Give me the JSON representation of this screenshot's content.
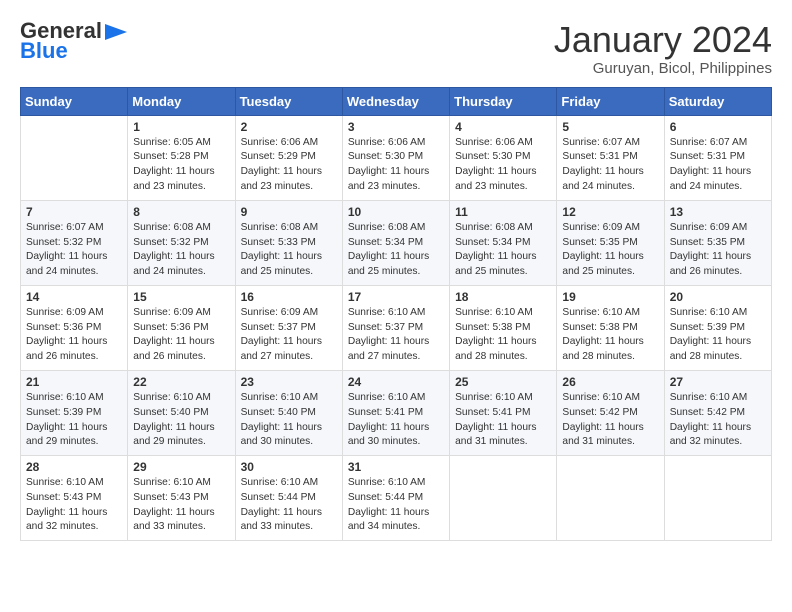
{
  "header": {
    "logo_general": "General",
    "logo_blue": "Blue",
    "month_title": "January 2024",
    "location": "Guruyan, Bicol, Philippines"
  },
  "days_of_week": [
    "Sunday",
    "Monday",
    "Tuesday",
    "Wednesday",
    "Thursday",
    "Friday",
    "Saturday"
  ],
  "weeks": [
    [
      {
        "day": "",
        "sunrise": "",
        "sunset": "",
        "daylight": ""
      },
      {
        "day": "1",
        "sunrise": "Sunrise: 6:05 AM",
        "sunset": "Sunset: 5:28 PM",
        "daylight": "Daylight: 11 hours and 23 minutes."
      },
      {
        "day": "2",
        "sunrise": "Sunrise: 6:06 AM",
        "sunset": "Sunset: 5:29 PM",
        "daylight": "Daylight: 11 hours and 23 minutes."
      },
      {
        "day": "3",
        "sunrise": "Sunrise: 6:06 AM",
        "sunset": "Sunset: 5:30 PM",
        "daylight": "Daylight: 11 hours and 23 minutes."
      },
      {
        "day": "4",
        "sunrise": "Sunrise: 6:06 AM",
        "sunset": "Sunset: 5:30 PM",
        "daylight": "Daylight: 11 hours and 23 minutes."
      },
      {
        "day": "5",
        "sunrise": "Sunrise: 6:07 AM",
        "sunset": "Sunset: 5:31 PM",
        "daylight": "Daylight: 11 hours and 24 minutes."
      },
      {
        "day": "6",
        "sunrise": "Sunrise: 6:07 AM",
        "sunset": "Sunset: 5:31 PM",
        "daylight": "Daylight: 11 hours and 24 minutes."
      }
    ],
    [
      {
        "day": "7",
        "sunrise": "Sunrise: 6:07 AM",
        "sunset": "Sunset: 5:32 PM",
        "daylight": "Daylight: 11 hours and 24 minutes."
      },
      {
        "day": "8",
        "sunrise": "Sunrise: 6:08 AM",
        "sunset": "Sunset: 5:32 PM",
        "daylight": "Daylight: 11 hours and 24 minutes."
      },
      {
        "day": "9",
        "sunrise": "Sunrise: 6:08 AM",
        "sunset": "Sunset: 5:33 PM",
        "daylight": "Daylight: 11 hours and 25 minutes."
      },
      {
        "day": "10",
        "sunrise": "Sunrise: 6:08 AM",
        "sunset": "Sunset: 5:34 PM",
        "daylight": "Daylight: 11 hours and 25 minutes."
      },
      {
        "day": "11",
        "sunrise": "Sunrise: 6:08 AM",
        "sunset": "Sunset: 5:34 PM",
        "daylight": "Daylight: 11 hours and 25 minutes."
      },
      {
        "day": "12",
        "sunrise": "Sunrise: 6:09 AM",
        "sunset": "Sunset: 5:35 PM",
        "daylight": "Daylight: 11 hours and 25 minutes."
      },
      {
        "day": "13",
        "sunrise": "Sunrise: 6:09 AM",
        "sunset": "Sunset: 5:35 PM",
        "daylight": "Daylight: 11 hours and 26 minutes."
      }
    ],
    [
      {
        "day": "14",
        "sunrise": "Sunrise: 6:09 AM",
        "sunset": "Sunset: 5:36 PM",
        "daylight": "Daylight: 11 hours and 26 minutes."
      },
      {
        "day": "15",
        "sunrise": "Sunrise: 6:09 AM",
        "sunset": "Sunset: 5:36 PM",
        "daylight": "Daylight: 11 hours and 26 minutes."
      },
      {
        "day": "16",
        "sunrise": "Sunrise: 6:09 AM",
        "sunset": "Sunset: 5:37 PM",
        "daylight": "Daylight: 11 hours and 27 minutes."
      },
      {
        "day": "17",
        "sunrise": "Sunrise: 6:10 AM",
        "sunset": "Sunset: 5:37 PM",
        "daylight": "Daylight: 11 hours and 27 minutes."
      },
      {
        "day": "18",
        "sunrise": "Sunrise: 6:10 AM",
        "sunset": "Sunset: 5:38 PM",
        "daylight": "Daylight: 11 hours and 28 minutes."
      },
      {
        "day": "19",
        "sunrise": "Sunrise: 6:10 AM",
        "sunset": "Sunset: 5:38 PM",
        "daylight": "Daylight: 11 hours and 28 minutes."
      },
      {
        "day": "20",
        "sunrise": "Sunrise: 6:10 AM",
        "sunset": "Sunset: 5:39 PM",
        "daylight": "Daylight: 11 hours and 28 minutes."
      }
    ],
    [
      {
        "day": "21",
        "sunrise": "Sunrise: 6:10 AM",
        "sunset": "Sunset: 5:39 PM",
        "daylight": "Daylight: 11 hours and 29 minutes."
      },
      {
        "day": "22",
        "sunrise": "Sunrise: 6:10 AM",
        "sunset": "Sunset: 5:40 PM",
        "daylight": "Daylight: 11 hours and 29 minutes."
      },
      {
        "day": "23",
        "sunrise": "Sunrise: 6:10 AM",
        "sunset": "Sunset: 5:40 PM",
        "daylight": "Daylight: 11 hours and 30 minutes."
      },
      {
        "day": "24",
        "sunrise": "Sunrise: 6:10 AM",
        "sunset": "Sunset: 5:41 PM",
        "daylight": "Daylight: 11 hours and 30 minutes."
      },
      {
        "day": "25",
        "sunrise": "Sunrise: 6:10 AM",
        "sunset": "Sunset: 5:41 PM",
        "daylight": "Daylight: 11 hours and 31 minutes."
      },
      {
        "day": "26",
        "sunrise": "Sunrise: 6:10 AM",
        "sunset": "Sunset: 5:42 PM",
        "daylight": "Daylight: 11 hours and 31 minutes."
      },
      {
        "day": "27",
        "sunrise": "Sunrise: 6:10 AM",
        "sunset": "Sunset: 5:42 PM",
        "daylight": "Daylight: 11 hours and 32 minutes."
      }
    ],
    [
      {
        "day": "28",
        "sunrise": "Sunrise: 6:10 AM",
        "sunset": "Sunset: 5:43 PM",
        "daylight": "Daylight: 11 hours and 32 minutes."
      },
      {
        "day": "29",
        "sunrise": "Sunrise: 6:10 AM",
        "sunset": "Sunset: 5:43 PM",
        "daylight": "Daylight: 11 hours and 33 minutes."
      },
      {
        "day": "30",
        "sunrise": "Sunrise: 6:10 AM",
        "sunset": "Sunset: 5:44 PM",
        "daylight": "Daylight: 11 hours and 33 minutes."
      },
      {
        "day": "31",
        "sunrise": "Sunrise: 6:10 AM",
        "sunset": "Sunset: 5:44 PM",
        "daylight": "Daylight: 11 hours and 34 minutes."
      },
      {
        "day": "",
        "sunrise": "",
        "sunset": "",
        "daylight": ""
      },
      {
        "day": "",
        "sunrise": "",
        "sunset": "",
        "daylight": ""
      },
      {
        "day": "",
        "sunrise": "",
        "sunset": "",
        "daylight": ""
      }
    ]
  ]
}
